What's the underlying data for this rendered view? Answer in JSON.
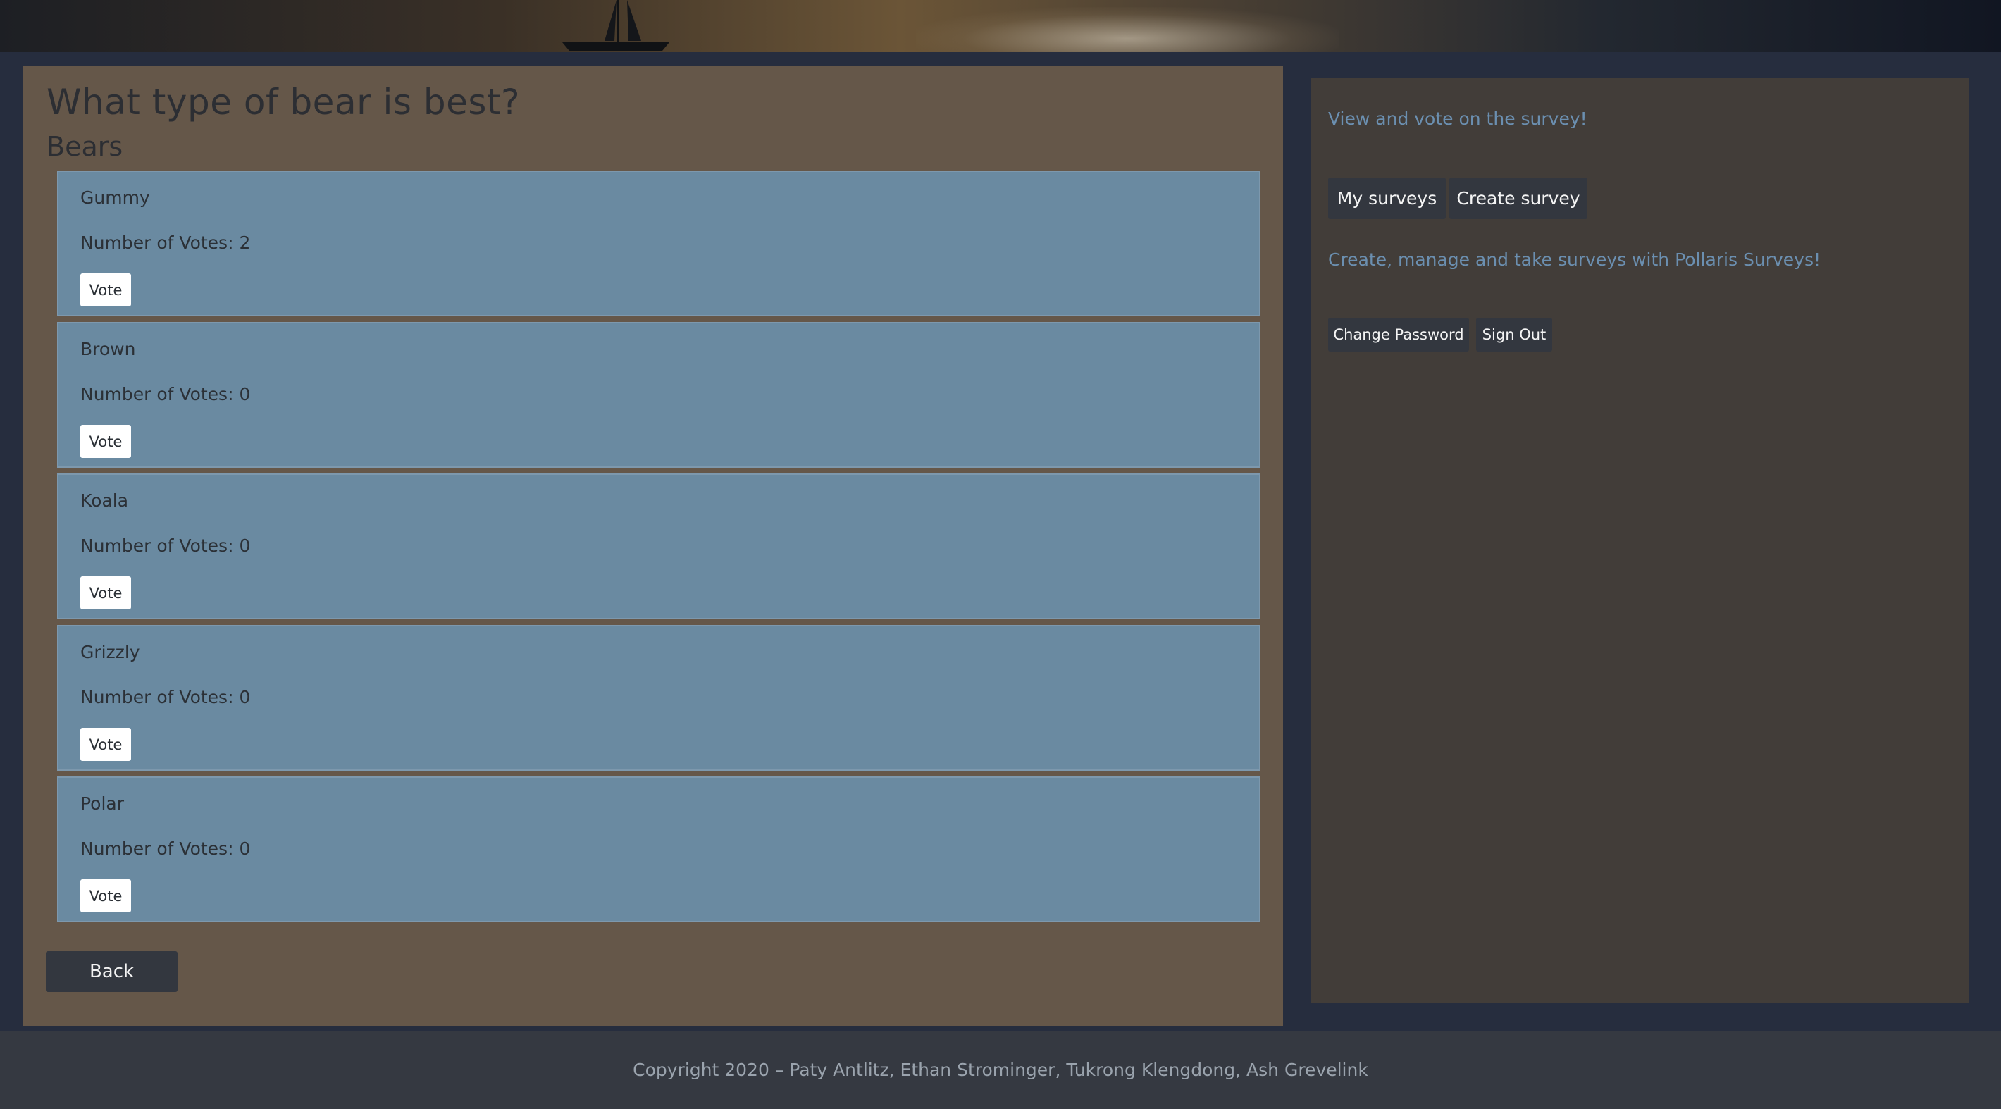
{
  "survey": {
    "title": "What type of bear is best?",
    "subtitle": "Bears",
    "votes_label": "Number of Votes:",
    "vote_button_label": "Vote",
    "back_label": "Back",
    "options": [
      {
        "name": "Gummy",
        "votes": "2"
      },
      {
        "name": "Brown",
        "votes": "0"
      },
      {
        "name": "Koala",
        "votes": "0"
      },
      {
        "name": "Grizzly",
        "votes": "0"
      },
      {
        "name": "Polar",
        "votes": "0"
      }
    ]
  },
  "sidebar": {
    "intro": "View and vote on the survey!",
    "my_surveys_label": "My surveys",
    "create_survey_label": "Create survey",
    "tagline": "Create, manage and take surveys with Pollaris Surveys!",
    "change_password_label": "Change Password",
    "sign_out_label": "Sign Out"
  },
  "footer": {
    "copyright": "Copyright 2020 – Paty Antlitz, Ethan Strominger, Tukrong Klengdong, Ash Grevelink"
  },
  "colors": {
    "background": "#262d3e",
    "main_card": "#655749",
    "option_card": "#6a8aa1",
    "side_card": "#423d39",
    "button_dark": "#33373f",
    "link_text": "#6b8fb0"
  }
}
